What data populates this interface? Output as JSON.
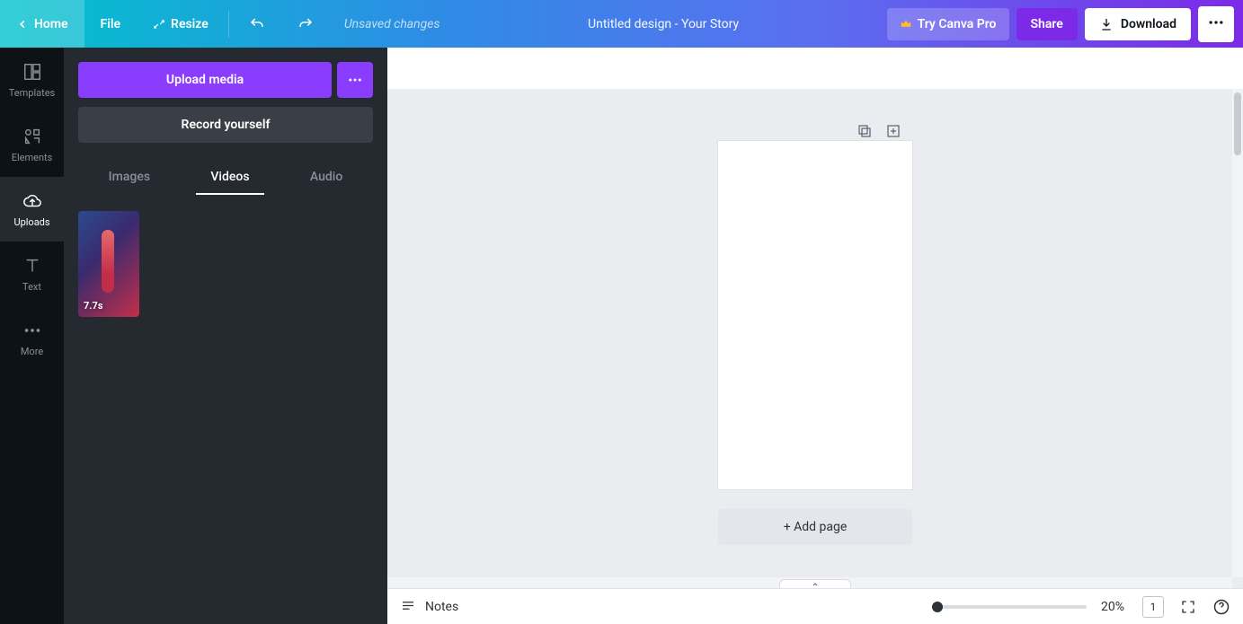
{
  "topbar": {
    "home": "Home",
    "file": "File",
    "resize": "Resize",
    "save_status": "Unsaved changes",
    "title": "Untitled design - Your Story",
    "try_pro": "Try Canva Pro",
    "share": "Share",
    "download": "Download"
  },
  "rail": {
    "templates": "Templates",
    "elements": "Elements",
    "uploads": "Uploads",
    "text": "Text",
    "more": "More"
  },
  "panel": {
    "upload": "Upload media",
    "record": "Record yourself",
    "tabs": {
      "images": "Images",
      "videos": "Videos",
      "audio": "Audio"
    },
    "thumbs": [
      {
        "duration": "7.7s"
      }
    ]
  },
  "canvas": {
    "add_page": "+ Add page"
  },
  "bottombar": {
    "notes": "Notes",
    "zoom": "20%",
    "page_count": "1"
  }
}
